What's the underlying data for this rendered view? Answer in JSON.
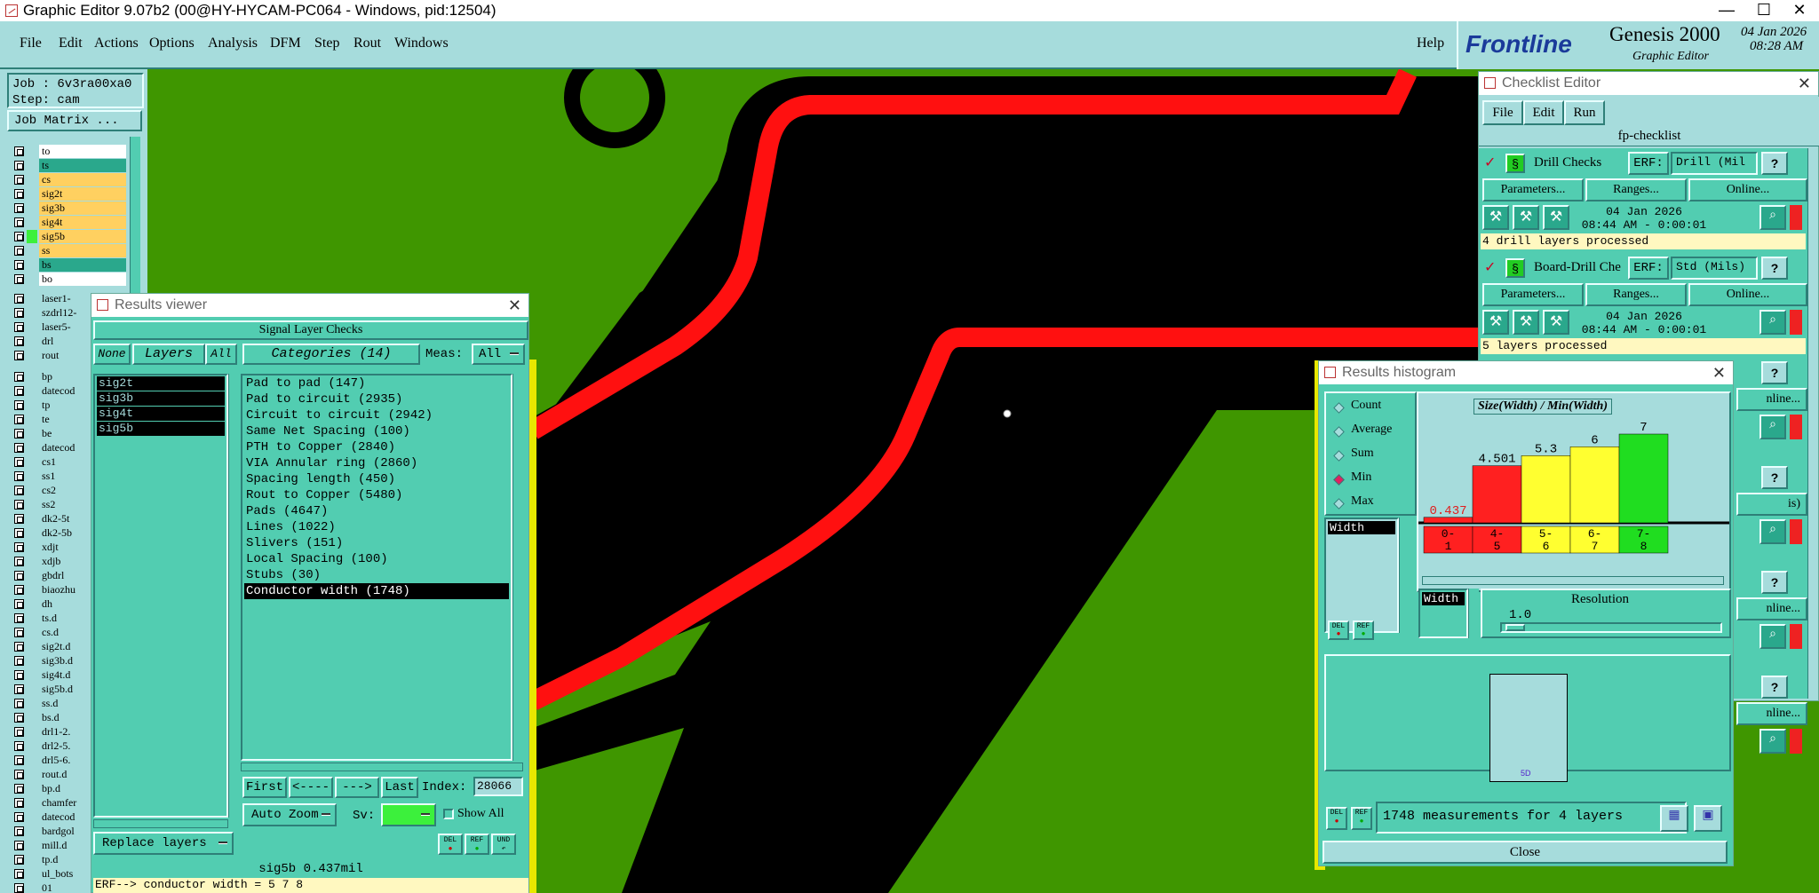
{
  "window": {
    "title": "Graphic Editor 9.07b2 (00@HY-HYCAM-PC064 - Windows, pid:12504)"
  },
  "menu": [
    "File",
    "Edit",
    "Actions",
    "Options",
    "Analysis",
    "DFM",
    "Step",
    "Rout",
    "Windows"
  ],
  "help": "Help",
  "brand": {
    "logo": "Frontline",
    "product": "Genesis 2000",
    "sub": "Graphic Editor",
    "date": "04 Jan 2026",
    "time": "08:28 AM"
  },
  "job": {
    "job": "Job : 6v3ra00xa0",
    "step": "Step: cam",
    "matrix": "Job Matrix ..."
  },
  "layers": [
    {
      "name": "to",
      "color": "#ffffff"
    },
    {
      "name": "ts",
      "color": "#2aa88c"
    },
    {
      "name": "cs",
      "color": "#ffd060"
    },
    {
      "name": "sig2t",
      "color": "#ffd060"
    },
    {
      "name": "sig3b",
      "color": "#ffd060"
    },
    {
      "name": "sig4t",
      "color": "#ffd060"
    },
    {
      "name": "sig5b",
      "color": "#ffd060"
    },
    {
      "name": "ss",
      "color": "#ffd060"
    },
    {
      "name": "bs",
      "color": "#2aa88c"
    },
    {
      "name": "bo",
      "color": "#ffffff"
    },
    {
      "name": "laser1-",
      "color": "#a6dcdc"
    },
    {
      "name": "szdrl12-",
      "color": "#a6dcdc"
    },
    {
      "name": "laser5-",
      "color": "#a6dcdc"
    },
    {
      "name": "drl",
      "color": "#a6dcdc"
    },
    {
      "name": "rout",
      "color": "#a6dcdc"
    },
    {
      "name": "bp",
      "color": "#a6dcdc"
    },
    {
      "name": "datecod",
      "color": "#a6dcdc"
    },
    {
      "name": "tp",
      "color": "#a6dcdc"
    },
    {
      "name": "te",
      "color": "#a6dcdc"
    },
    {
      "name": "be",
      "color": "#a6dcdc"
    },
    {
      "name": "datecod",
      "color": "#a6dcdc"
    },
    {
      "name": "cs1",
      "color": "#a6dcdc"
    },
    {
      "name": "ss1",
      "color": "#a6dcdc"
    },
    {
      "name": "cs2",
      "color": "#a6dcdc"
    },
    {
      "name": "ss2",
      "color": "#a6dcdc"
    },
    {
      "name": "dk2-5t",
      "color": "#a6dcdc"
    },
    {
      "name": "dk2-5b",
      "color": "#a6dcdc"
    },
    {
      "name": "xdjt",
      "color": "#a6dcdc"
    },
    {
      "name": "xdjb",
      "color": "#a6dcdc"
    },
    {
      "name": "gbdrl",
      "color": "#a6dcdc"
    },
    {
      "name": "biaozhu",
      "color": "#a6dcdc"
    },
    {
      "name": "dh",
      "color": "#a6dcdc"
    },
    {
      "name": "ts.d",
      "color": "#a6dcdc"
    },
    {
      "name": "cs.d",
      "color": "#a6dcdc"
    },
    {
      "name": "sig2t.d",
      "color": "#a6dcdc"
    },
    {
      "name": "sig3b.d",
      "color": "#a6dcdc"
    },
    {
      "name": "sig4t.d",
      "color": "#a6dcdc"
    },
    {
      "name": "sig5b.d",
      "color": "#a6dcdc"
    },
    {
      "name": "ss.d",
      "color": "#a6dcdc"
    },
    {
      "name": "bs.d",
      "color": "#a6dcdc"
    },
    {
      "name": "drl1-2.",
      "color": "#a6dcdc"
    },
    {
      "name": "drl2-5.",
      "color": "#a6dcdc"
    },
    {
      "name": "drl5-6.",
      "color": "#a6dcdc"
    },
    {
      "name": "rout.d",
      "color": "#a6dcdc"
    },
    {
      "name": "bp.d",
      "color": "#a6dcdc"
    },
    {
      "name": "chamfer",
      "color": "#a6dcdc"
    },
    {
      "name": "datecod",
      "color": "#a6dcdc"
    },
    {
      "name": "bardgol",
      "color": "#a6dcdc"
    },
    {
      "name": "mill.d",
      "color": "#a6dcdc"
    },
    {
      "name": "tp.d",
      "color": "#a6dcdc"
    },
    {
      "name": "ul_bots",
      "color": "#a6dcdc"
    },
    {
      "name": "01",
      "color": "#a6dcdc"
    }
  ],
  "results_viewer": {
    "title": "Results viewer",
    "header": "Signal Layer Checks",
    "none": "None",
    "layers_tab": "Layers",
    "all_tab": "All",
    "categories_label": "Categories (14)",
    "meas_label": "Meas:",
    "meas_value": "All",
    "selected_layers": [
      "sig2t",
      "sig3b",
      "sig4t",
      "sig5b"
    ],
    "categories": [
      "Pad to pad (147)",
      "Pad to circuit (2935)",
      "Circuit to circuit (2942)",
      "Same Net Spacing (100)",
      "PTH to Copper (2840)",
      "VIA Annular ring (2860)",
      "Spacing length (450)",
      "Rout to Copper (5480)",
      "Pads (4647)",
      "Lines (1022)",
      "Slivers (151)",
      "Local Spacing (100)",
      "Stubs (30)",
      "Conductor width (1748)"
    ],
    "selected_category": "Conductor width (1748)",
    "first": "First",
    "prev": "<----",
    "next": "--->",
    "last": "Last",
    "index_label": "Index:",
    "index_value": "28066",
    "auto_zoom": "Auto Zoom",
    "sv_label": "Sv:",
    "show_all": "Show All",
    "replace_layers": "Replace layers",
    "del": "DEL",
    "ref": "REF",
    "und": "UND",
    "status": "sig5b 0.437mil",
    "erf": "ERF--> conductor width = 5 7 8"
  },
  "checklist": {
    "title": "Checklist Editor",
    "menu": [
      "File",
      "Edit",
      "Run"
    ],
    "name": "fp-checklist",
    "items": [
      {
        "name": "Drill Checks",
        "erf_label": "ERF:",
        "erf": "Drill (Mil",
        "params": "Parameters...",
        "ranges": "Ranges...",
        "online": "Online...",
        "date": "04 Jan 2026",
        "time": "08:44 AM - 0:00:01",
        "status": "4 drill layers processed"
      },
      {
        "name": "Board-Drill Che",
        "erf_label": "ERF:",
        "erf": "Std (Mils)",
        "params": "Parameters...",
        "ranges": "Ranges...",
        "online": "Online...",
        "date": "04 Jan 2026",
        "time": "08:44 AM - 0:00:01",
        "status": "5 layers processed"
      }
    ],
    "partial": [
      "nline...",
      "is)",
      "nline...",
      "nline..."
    ]
  },
  "histogram": {
    "title": "Results histogram",
    "options": [
      "Count",
      "Average",
      "Sum",
      "Min",
      "Max"
    ],
    "selected_option": "Min",
    "field": "Width",
    "chart_title": "Size(Width) / Min(Width)",
    "resolution_label": "Resolution",
    "resolution_value": "1.0",
    "summary": "1748 measurements for 4 layers",
    "close": "Close",
    "del": "DEL",
    "ref": "REF",
    "hint": "5D"
  },
  "chart_data": {
    "type": "bar",
    "title": "Size(Width) / Min(Width)",
    "categories": [
      "0-1",
      "4-5",
      "5-6",
      "6-7",
      "7-8"
    ],
    "category_lines": [
      [
        "0-",
        "1"
      ],
      [
        "4-",
        "5"
      ],
      [
        "5-",
        "6"
      ],
      [
        "6-",
        "7"
      ],
      [
        "7-",
        "8"
      ]
    ],
    "values": [
      0.437,
      4.501,
      5.3,
      6,
      7
    ],
    "labels": [
      "0.437",
      "4.501",
      "5.3",
      "6",
      "7"
    ],
    "colors": [
      "#ff2020",
      "#ff2020",
      "#ffff30",
      "#ffff30",
      "#20dd20"
    ],
    "ylim": [
      0,
      7
    ]
  }
}
